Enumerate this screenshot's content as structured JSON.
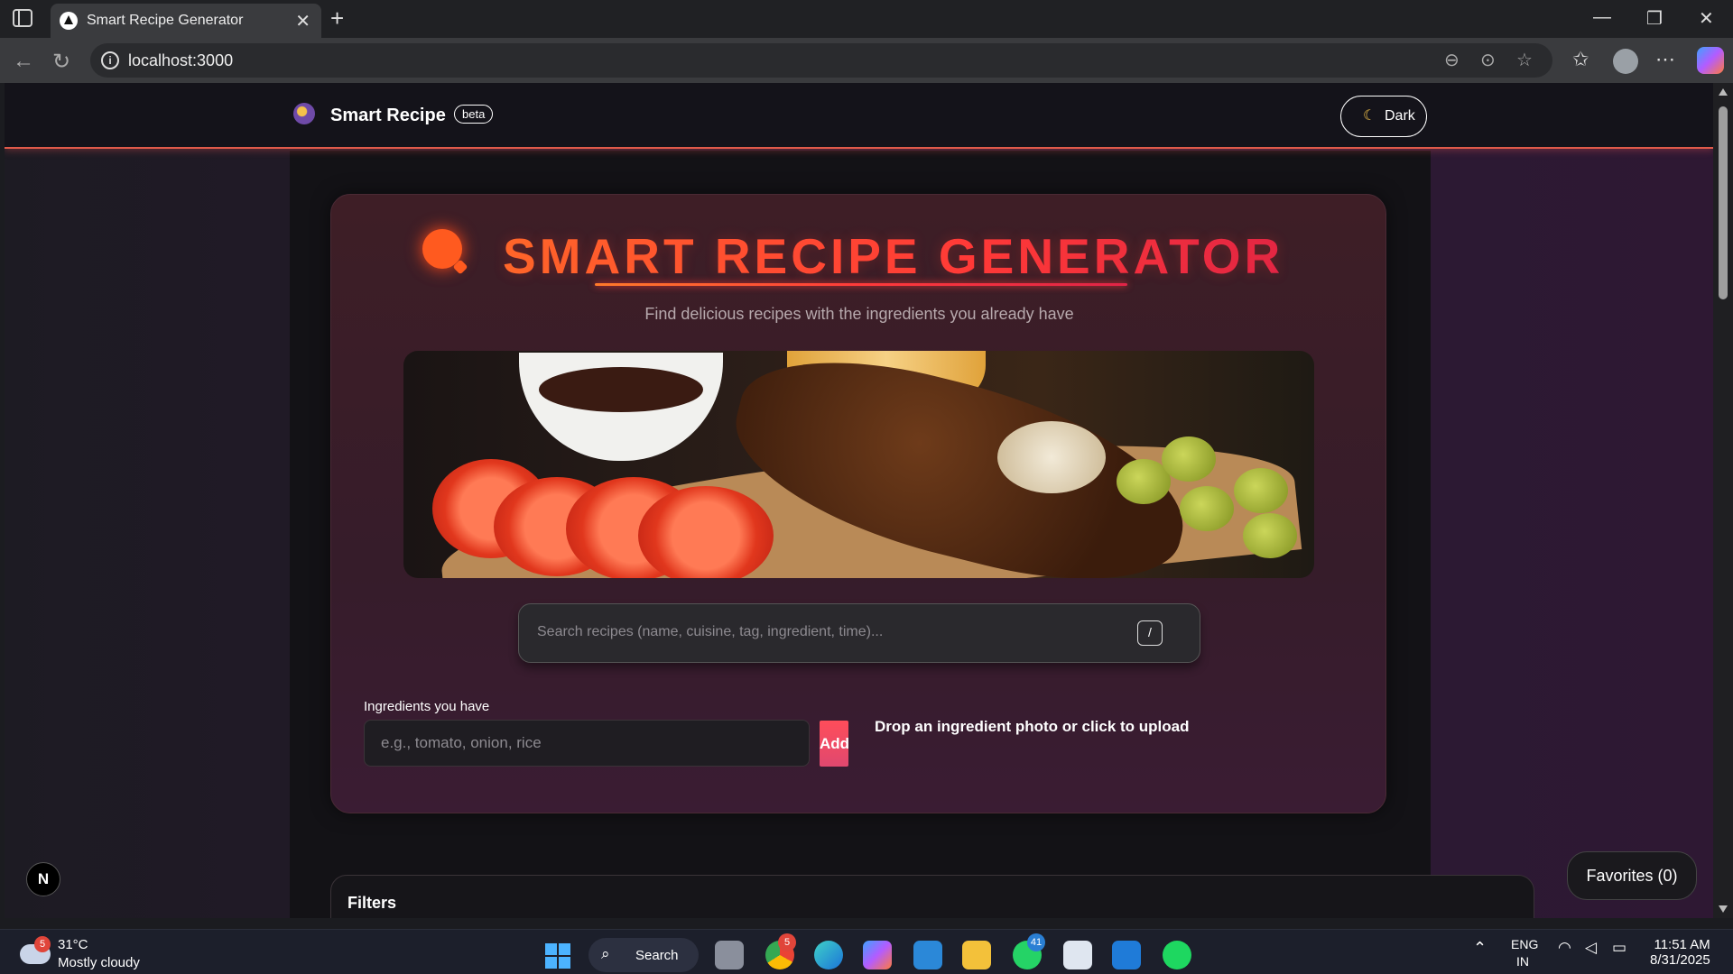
{
  "browser": {
    "tab_title": "Smart Recipe Generator",
    "url": "localhost:3000"
  },
  "nav": {
    "brand": "Smart Recipe",
    "badge": "beta",
    "theme_button": "Dark"
  },
  "hero": {
    "title": "SMART RECIPE GENERATOR",
    "subtitle": "Find delicious recipes with the ingredients you already have"
  },
  "search": {
    "placeholder": "Search recipes (name, cuisine, tag, ingredient, time)...",
    "shortcut": "/"
  },
  "ingredients": {
    "label": "Ingredients you have",
    "placeholder": "e.g., tomato, onion, rice",
    "add_button": "Add",
    "drop_text": "Drop an ingredient photo or click to upload"
  },
  "floating": {
    "n_badge": "N",
    "favorites": "Favorites (0)"
  },
  "filters": {
    "title": "Filters"
  },
  "taskbar": {
    "weather_badge": "5",
    "temperature": "31°C",
    "condition": "Mostly cloudy",
    "search": "Search",
    "chrome_badge": "5",
    "whatsapp_badge": "41",
    "lang_1": "ENG",
    "lang_2": "IN",
    "time": "11:51 AM",
    "date": "8/31/2025"
  },
  "icons": [
    "sidebar-toggle-icon",
    "close-icon",
    "plus-icon",
    "back-icon",
    "reload-icon",
    "info-icon",
    "zoom-out-icon",
    "reader-icon",
    "star-icon",
    "favorites-icon",
    "profile-icon",
    "more-icon",
    "copilot-icon",
    "search-logo-icon",
    "moon-icon",
    "windows-icon",
    "search-icon",
    "wifi-icon",
    "volume-icon",
    "battery-icon"
  ],
  "colors": {
    "accent_orange": "#ff5a1f",
    "accent_red": "#e02447",
    "add_button": "#ff4d5a"
  }
}
